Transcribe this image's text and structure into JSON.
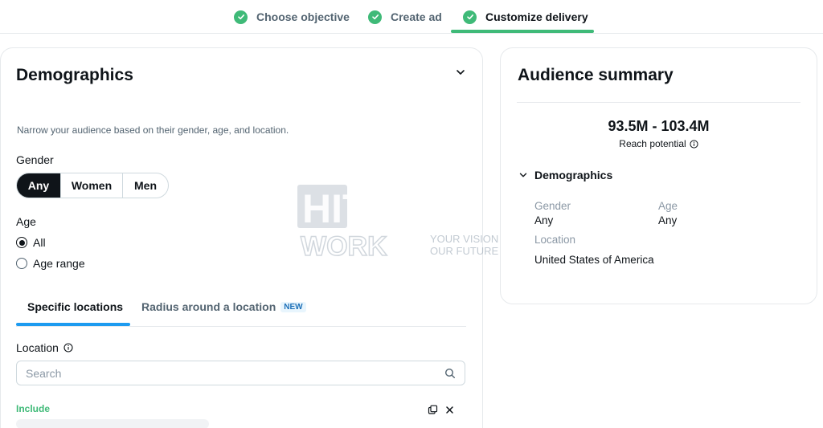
{
  "stepper": {
    "steps": [
      {
        "label": "Choose objective",
        "state": "done"
      },
      {
        "label": "Create ad",
        "state": "done"
      },
      {
        "label": "Customize delivery",
        "state": "active"
      }
    ]
  },
  "demographics": {
    "title": "Demographics",
    "description": "Narrow your audience based on their gender, age, and location.",
    "gender": {
      "label": "Gender",
      "options": [
        "Any",
        "Women",
        "Men"
      ],
      "selected": "Any"
    },
    "age": {
      "label": "Age",
      "options": [
        "All",
        "Age range"
      ],
      "selected": "All"
    },
    "tabs": [
      {
        "label": "Specific locations",
        "active": true
      },
      {
        "label": "Radius around a location",
        "badge": "NEW",
        "active": false
      }
    ],
    "location": {
      "label": "Location",
      "placeholder": "Search"
    },
    "include_label": "Include"
  },
  "audience_summary": {
    "title": "Audience summary",
    "reach": "93.5M - 103.4M",
    "reach_label": "Reach potential",
    "section_title": "Demographics",
    "gender_label": "Gender",
    "gender_value": "Any",
    "age_label": "Age",
    "age_value": "Any",
    "location_label": "Location",
    "location_value": "United States of America"
  },
  "watermark": {
    "brand_top": "HITECH",
    "brand_bottom": "WORK",
    "tagline_1": "YOUR VISION",
    "tagline_2": "OUR FUTURE"
  },
  "colors": {
    "accent_green": "#3fba78",
    "accent_blue": "#1d9bf0",
    "text_primary": "#0f1419",
    "text_secondary": "#536471"
  }
}
